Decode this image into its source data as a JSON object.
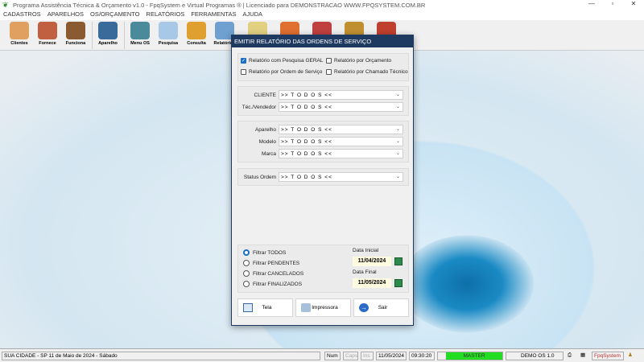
{
  "window": {
    "title": "Programa Assistência Técnica & Orçamento v1.0 - FpqSystem e Virtual Programas ® | Licenciado para  DEMONSTRACAO WWW.FPQSYSTEM.COM.BR"
  },
  "menu": [
    "CADASTROS",
    "APARELHOS",
    "OS/ORÇAMENTO",
    "RELATÓRIOS",
    "FERRAMENTAS",
    "AJUDA"
  ],
  "toolbar": [
    "Clientes",
    "Fornece",
    "Funciona",
    "Aparelho",
    "Menu OS",
    "Pesquisa",
    "Consulta",
    "Relatórios"
  ],
  "dialog": {
    "title": "EMITIR RELATÓRIO DAS ORDENS DE SERVIÇO",
    "report_types": [
      {
        "label": "Relatório com Pesquisa GERAL",
        "checked": true
      },
      {
        "label": "Relatório por Orçamento",
        "checked": false
      },
      {
        "label": "Relatório por Ordem de Serviço",
        "checked": false
      },
      {
        "label": "Relatório por Chamado Técnico",
        "checked": false
      }
    ],
    "filters": [
      {
        "label": "CLIENTE",
        "value": ">> T O D O S <<"
      },
      {
        "label": "Téc./Vendedor",
        "value": ">> T O D O S <<"
      },
      {
        "label": "Aparelho",
        "value": ">> T O D O S <<"
      },
      {
        "label": "Modelo",
        "value": ">> T O D O S <<"
      },
      {
        "label": "Marca",
        "value": ">> T O D O S <<"
      },
      {
        "label": "Status Ordem",
        "value": ">> T O D O S <<"
      }
    ],
    "status_filters": [
      {
        "label": "Filtrar TODOS",
        "selected": true
      },
      {
        "label": "Filtrar PENDENTES",
        "selected": false
      },
      {
        "label": "Filtrar CANCELADOS",
        "selected": false
      },
      {
        "label": "Filtrar FINALIZADOS",
        "selected": false
      }
    ],
    "date_start_label": "Data Inicial",
    "date_start": "11/04/2024",
    "date_end_label": "Data Final",
    "date_end": "11/05/2024",
    "buttons": {
      "screen": "Tela",
      "printer": "Impressora",
      "exit": "Sair"
    }
  },
  "status": {
    "city": "SUA CIDADE - SP 11 de Maio de 2024 - Sábado",
    "num": "Num",
    "caps": "Caps",
    "ins": "Ins",
    "date": "11/05/2024",
    "time": "09:30:20",
    "user": "MASTER",
    "version": "DEMO OS 1.0",
    "brand": "FpqSystem"
  }
}
